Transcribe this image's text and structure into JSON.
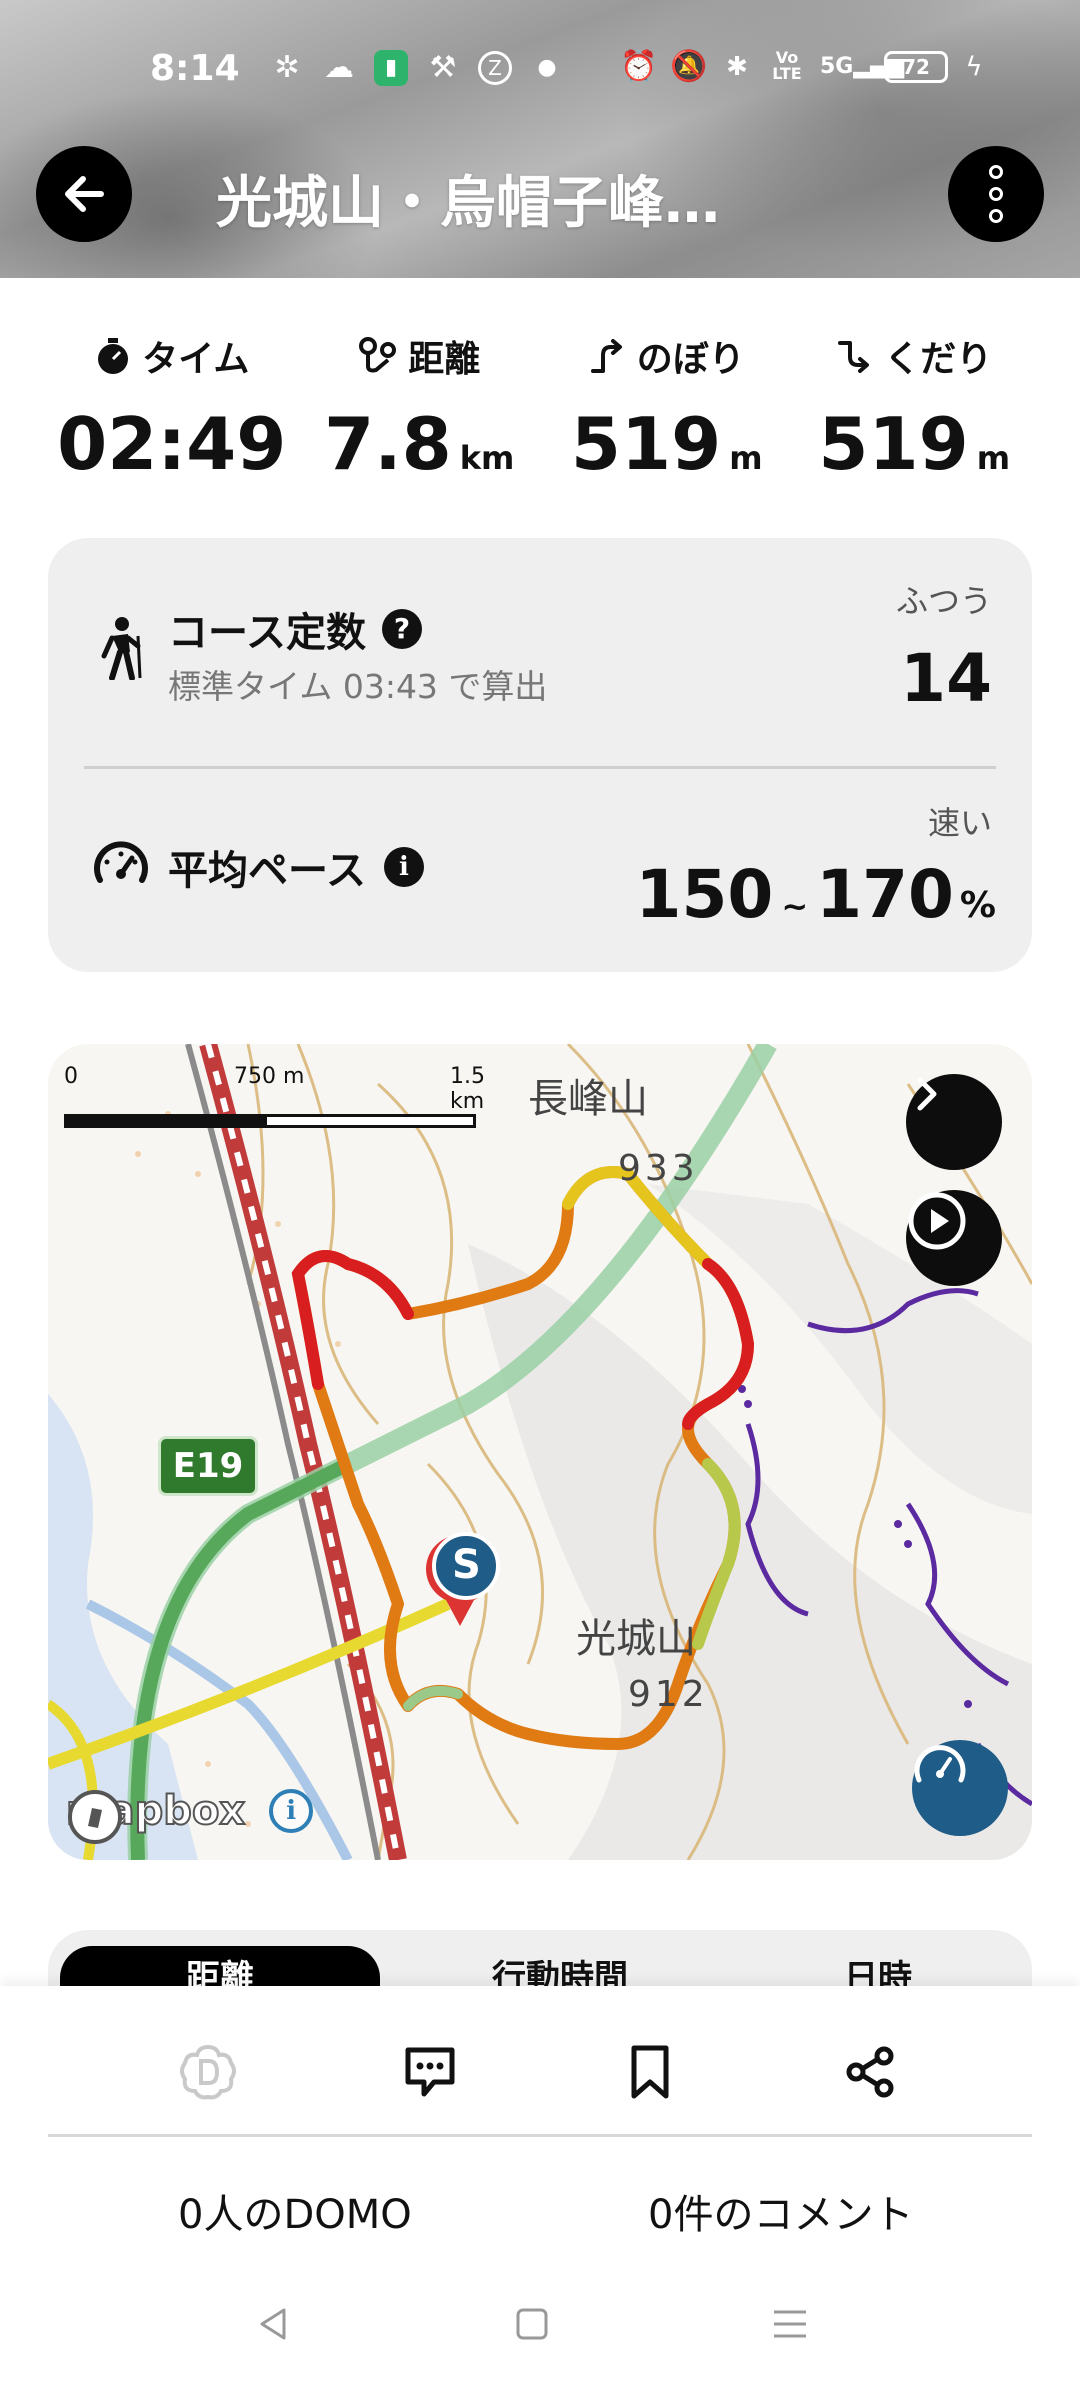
{
  "status_bar": {
    "time": "8:14",
    "battery": "72",
    "icons": [
      "pinwheel-icon",
      "cloud-sun-icon",
      "battery-saver-icon",
      "hammer-icon",
      "z-badge-icon",
      "dot-icon",
      "alarm-icon",
      "mute-icon",
      "bluetooth-icon",
      "volte-icon",
      "5g-signal-icon",
      "charging-icon"
    ]
  },
  "header": {
    "title": "光城山・烏帽子峰…",
    "back_icon": "arrow-left-icon",
    "more_icon": "more-vertical-icon"
  },
  "stats": [
    {
      "label": "タイム",
      "value": "02:49",
      "unit": "",
      "icon": "stopwatch-icon"
    },
    {
      "label": "距離",
      "value": "7.8",
      "unit": "km",
      "icon": "route-distance-icon"
    },
    {
      "label": "のぼり",
      "value": "519",
      "unit": "m",
      "icon": "ascent-icon"
    },
    {
      "label": "くだり",
      "value": "519",
      "unit": "m",
      "icon": "descent-icon"
    }
  ],
  "course": {
    "title": "コース定数",
    "help": "?",
    "subtitle": "標準タイム 03:43 で算出",
    "level_label": "ふつう",
    "level_value": "14"
  },
  "pace": {
    "title": "平均ペース",
    "info": "i",
    "speed_label": "速い",
    "min": "150",
    "tilde": "~",
    "max": "170",
    "unit": "%"
  },
  "map": {
    "scale_labels": [
      "0",
      "750 m",
      "1.5 km"
    ],
    "peak_north": "長峰山",
    "peak_north_elev": "933",
    "peak_south": "光城山",
    "peak_south_elev": "912",
    "road_badge": "E19",
    "start_marker": "S",
    "attribution": "mapbox",
    "info": "i",
    "colors": {
      "fast": "#d81e1e",
      "mid": "#e98a12",
      "slow": "#e5c41e",
      "easy": "#b8c84a",
      "rail": "#c23b3b",
      "highway": "#5aa65a",
      "river": "#aac7e8"
    }
  },
  "tabs": [
    "距離",
    "行動時間",
    "日時"
  ],
  "actions": [
    {
      "name": "domo-icon",
      "color": "#c9c9c9"
    },
    {
      "name": "comment-icon",
      "color": "#111111"
    },
    {
      "name": "bookmark-icon",
      "color": "#111111"
    },
    {
      "name": "share-icon",
      "color": "#111111"
    }
  ],
  "counts": {
    "domo": "0人のDOMO",
    "comments": "0件のコメント"
  },
  "navbar": [
    "back-triangle-icon",
    "home-square-icon",
    "recents-menu-icon"
  ]
}
